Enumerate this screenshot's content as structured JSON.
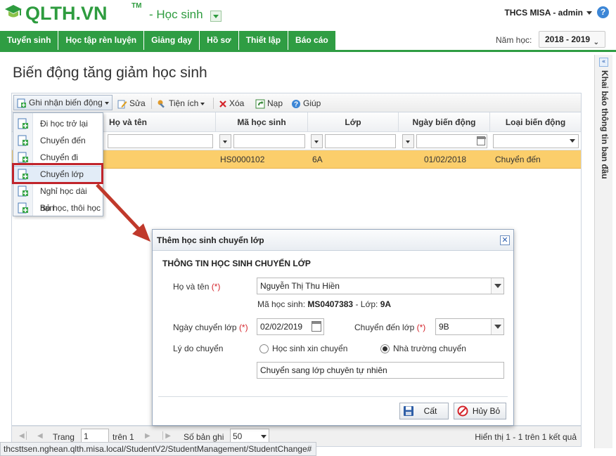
{
  "header": {
    "logo_text": "QLTH.VN",
    "logo_tm": "TM",
    "module": "- Học sinh",
    "school_user": "THCS MISA - admin",
    "help": "?"
  },
  "nav": {
    "items": [
      "Tuyển sinh",
      "Học tập rèn luyện",
      "Giảng dạy",
      "Hồ sơ",
      "Thiết lập",
      "Báo cáo"
    ],
    "year_label": "Năm học:",
    "year_value": "2018 - 2019"
  },
  "right_panel": {
    "label": "Khai báo thông tin ban đầu"
  },
  "page": {
    "title": "Biến động tăng giảm học sinh"
  },
  "toolbar": {
    "record": "Ghi nhận biến động",
    "edit": "Sửa",
    "utility": "Tiện ích",
    "delete": "Xóa",
    "reload": "Nạp",
    "help": "Giúp"
  },
  "grid": {
    "columns": [
      "Họ và tên",
      "Mã học sinh",
      "Lớp",
      "Ngày biến động",
      "Loại biến động"
    ],
    "rows": [
      {
        "name": "",
        "code": "HS0000102",
        "class": "6A",
        "date": "01/02/2018",
        "type": "Chuyển đến"
      }
    ]
  },
  "menu": {
    "items": [
      "Đi học trở lại",
      "Chuyển đến",
      "Chuyển đi",
      "Chuyển lớp",
      "Nghỉ học dài hạn",
      "Bỏ học, thôi học"
    ],
    "selected": "Chuyển lớp"
  },
  "pager": {
    "page_label": "Trang",
    "page_value": "1",
    "of_label": "trên 1",
    "records_label": "Số bản ghi",
    "records_value": "50",
    "summary": "Hiển thị 1 - 1 trên 1 kết quả"
  },
  "status_url": "thcsttsen.nghean.qlth.misa.local/StudentV2/StudentManagement/StudentChange#",
  "dialog": {
    "title": "Thêm học sinh chuyển lớp",
    "section": "THÔNG TIN HỌC SINH CHUYỂN LỚP",
    "name_label": "Họ và tên",
    "name_value": "Nguyễn Thị Thu Hiền",
    "code_prefix": "Mã học sinh:",
    "code_value": "MS0407383",
    "class_prefix": "- Lớp:",
    "class_value": "9A",
    "date_label": "Ngày chuyển lớp",
    "date_value": "02/02/2019",
    "to_class_label": "Chuyển đến lớp",
    "to_class_value": "9B",
    "reason_label": "Lý do chuyển",
    "reason_opt1": "Học sinh xin chuyển",
    "reason_opt2": "Nhà trường chuyển",
    "reason_selected": "Nhà trường chuyển",
    "note_value": "Chuyển sang lớp chuyên tự nhiên",
    "required_mark": "(*)",
    "save": "Cất",
    "cancel": "Hủy Bỏ"
  },
  "colors": {
    "brand_green": "#2f9d43",
    "row_highlight": "#fbce6b",
    "callout_red": "#c0242b"
  }
}
